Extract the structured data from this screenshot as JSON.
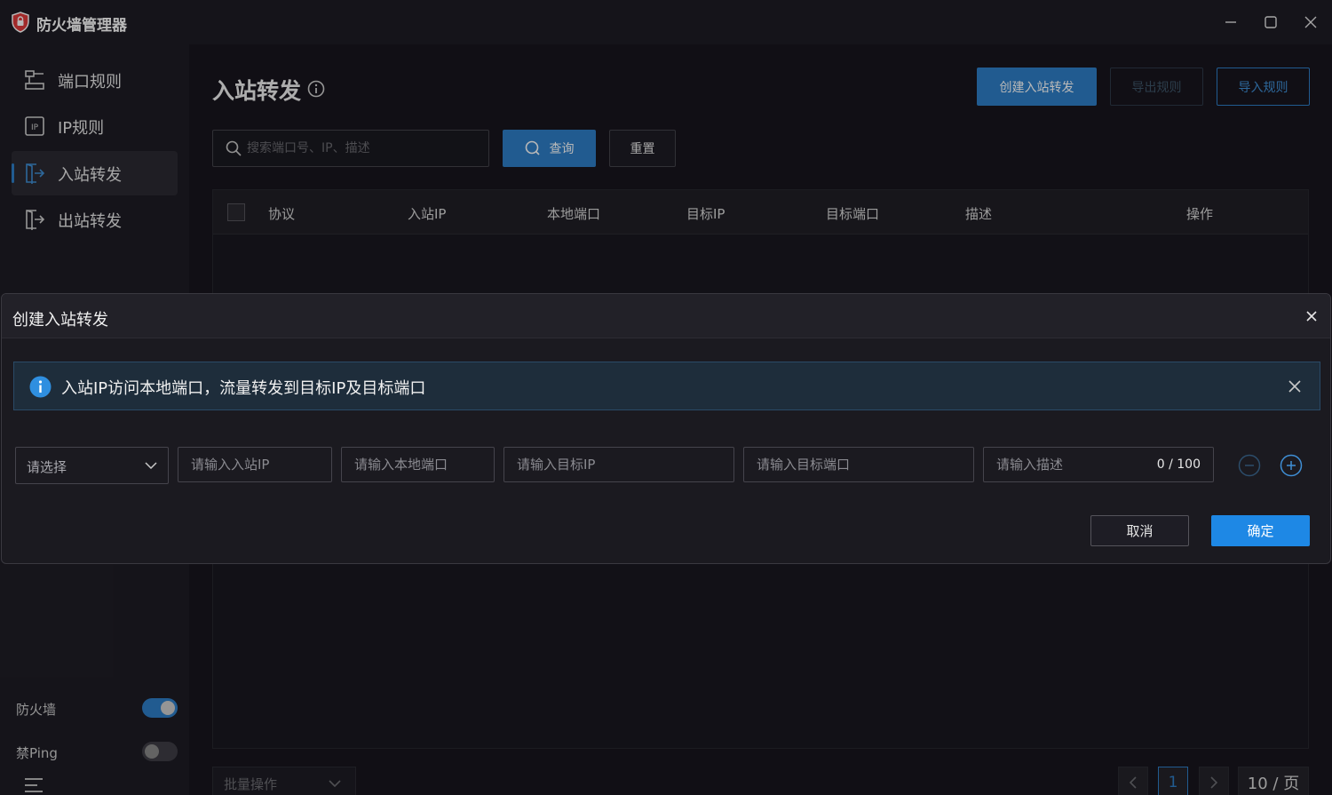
{
  "window": {
    "title": "防火墙管理器"
  },
  "sidebar": {
    "items": [
      {
        "label": "端口规则",
        "icon": "port-rules-icon"
      },
      {
        "label": "IP规则",
        "icon": "ip-rules-icon"
      },
      {
        "label": "入站转发",
        "icon": "inbound-forward-icon",
        "active": true
      },
      {
        "label": "出站转发",
        "icon": "outbound-forward-icon"
      }
    ],
    "toggles": {
      "firewall": {
        "label": "防火墙",
        "on": true
      },
      "block_ping": {
        "label": "禁Ping",
        "on": false
      }
    }
  },
  "main": {
    "title": "入站转发",
    "actions": {
      "create": "创建入站转发",
      "export": "导出规则",
      "import": "导入规则"
    },
    "search": {
      "placeholder": "搜索端口号、IP、描述",
      "query_label": "查询",
      "reset_label": "重置"
    },
    "table": {
      "columns": [
        "协议",
        "入站IP",
        "本地端口",
        "目标IP",
        "目标端口",
        "描述",
        "操作"
      ]
    },
    "footer": {
      "batch_label": "批量操作",
      "current_page": "1",
      "page_size": "10 / 页"
    }
  },
  "dialog": {
    "title": "创建入站转发",
    "alert": "入站IP访问本地端口，流量转发到目标IP及目标端口",
    "form": {
      "protocol_placeholder": "请选择",
      "inbound_ip_placeholder": "请输入入站IP",
      "local_port_placeholder": "请输入本地端口",
      "target_ip_placeholder": "请输入目标IP",
      "target_port_placeholder": "请输入目标端口",
      "description_placeholder": "请输入描述",
      "description_counter": "0 / 100"
    },
    "cancel_label": "取消",
    "confirm_label": "确定"
  },
  "colors": {
    "accent": "#2f7ec8",
    "background": "#17161d",
    "sidebar": "#1e1d25"
  }
}
